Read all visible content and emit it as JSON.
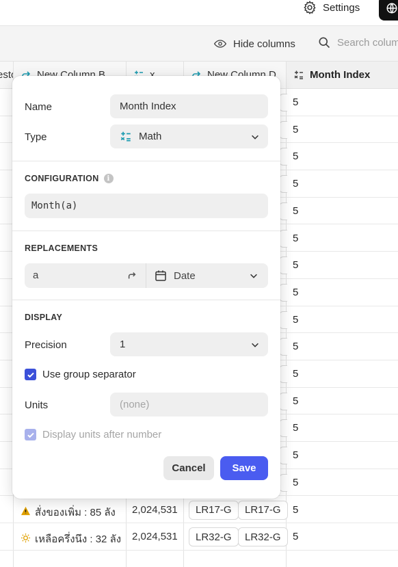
{
  "topbar": {
    "settings_label": "Settings"
  },
  "toolbar": {
    "hide_columns_label": "Hide columns",
    "search_placeholder": "Search colum"
  },
  "columns": {
    "c0_partial": "esto",
    "c1": "New Column B",
    "c2": "x",
    "c3": "New Column D",
    "c4": "Month Index"
  },
  "rows": [
    {
      "month_index": "5"
    },
    {
      "month_index": "5"
    },
    {
      "month_index": "5"
    },
    {
      "month_index": "5"
    },
    {
      "month_index": "5"
    },
    {
      "month_index": "5"
    },
    {
      "month_index": "5"
    },
    {
      "month_index": "5"
    },
    {
      "month_index": "5"
    },
    {
      "month_index": "5"
    },
    {
      "month_index": "5"
    },
    {
      "month_index": "5"
    },
    {
      "month_index": "5"
    },
    {
      "month_index": "5"
    },
    {
      "month_index": "5"
    },
    {
      "month_index": "5",
      "status": "สั่งของเพิ่ม : 85 ลัง",
      "x": "2,024,531",
      "chip1": "LR17-G",
      "chip2": "LR17-G"
    },
    {
      "month_index": "5",
      "status": "เหลือครึ่งนึง : 32 ลัง",
      "x": "2,024,531",
      "chip1": "LR32-G",
      "chip2": "LR32-G"
    }
  ],
  "popover": {
    "name_label": "Name",
    "name_value": "Month Index",
    "type_label": "Type",
    "type_value": "Math",
    "configuration_title": "CONFIGURATION",
    "formula": "Month(a)",
    "replacements_title": "REPLACEMENTS",
    "replacement_var": "a",
    "replacement_type": "Date",
    "display_title": "DISPLAY",
    "precision_label": "Precision",
    "precision_value": "1",
    "group_separator_label": "Use group separator",
    "group_separator_checked": true,
    "units_label": "Units",
    "units_placeholder": "(none)",
    "units_after_label": "Display units after number",
    "units_after_checked": true,
    "cancel_label": "Cancel",
    "save_label": "Save"
  },
  "colors": {
    "accent": "#4a5cf0",
    "checkbox": "#3b50d9",
    "teal_icon": "#1a9bb0",
    "warning": "#e0a000"
  },
  "icons": [
    "gear-icon",
    "globe-icon",
    "eye-icon",
    "search-icon",
    "math-icon",
    "formula-arrow-icon",
    "calendar-icon",
    "chevron-down-icon",
    "info-icon",
    "check-icon",
    "warning-icon",
    "sun-icon"
  ]
}
